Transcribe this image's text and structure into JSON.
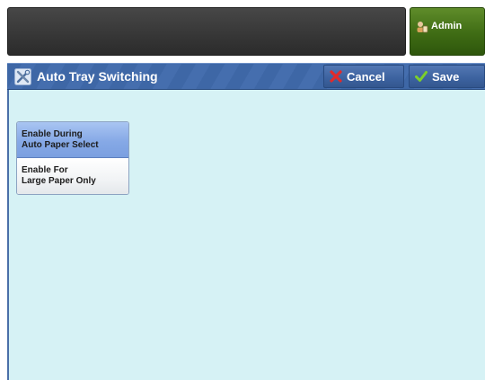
{
  "header": {
    "admin_label": "Admin"
  },
  "title_bar": {
    "title": "Auto Tray Switching",
    "cancel_label": "Cancel",
    "save_label": "Save"
  },
  "options": {
    "items": [
      {
        "line1": "Enable During",
        "line2": "Auto Paper Select",
        "selected": true
      },
      {
        "line1": "Enable For",
        "line2": "Large Paper Only",
        "selected": false
      }
    ]
  },
  "colors": {
    "content_bg": "#d6f2f5",
    "title_bar_blue": "#3e67a6",
    "admin_green": "#3f6c14",
    "selected_option": "#86a9e6"
  },
  "icons": {
    "admin": "admin-user-icon",
    "title": "tools-icon",
    "cancel": "red-x-icon",
    "save": "green-check-icon"
  }
}
